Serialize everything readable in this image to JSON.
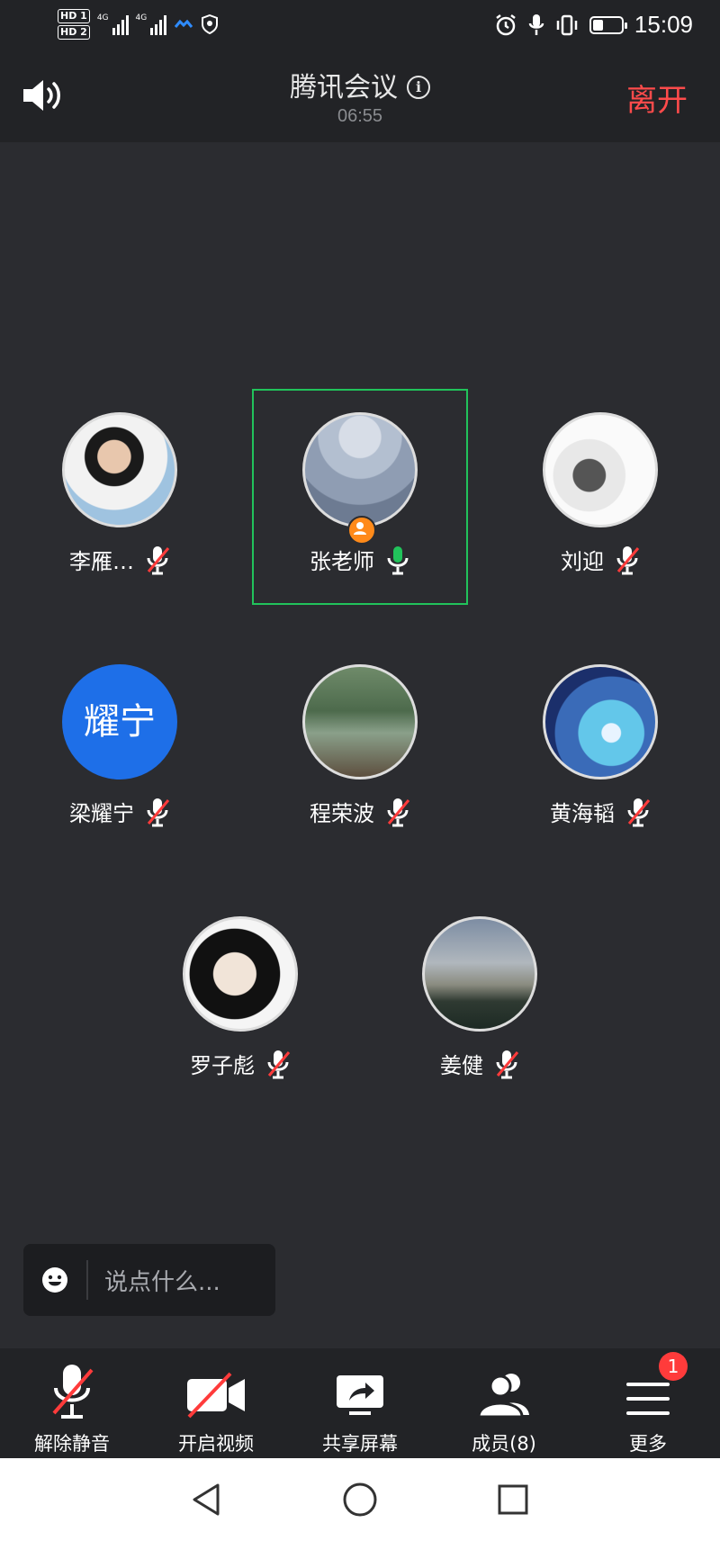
{
  "status_bar": {
    "sim1": "HD 1",
    "sim2": "HD 2",
    "network": "4G",
    "time": "15:09",
    "icons": [
      "hd-icon",
      "signal-icon",
      "wifi-icon",
      "vpn-icon",
      "alarm-icon",
      "mic-icon",
      "vibrate-icon",
      "battery-icon"
    ],
    "battery_level": 0.35
  },
  "header": {
    "title": "腾讯会议",
    "timer": "06:55",
    "leave_label": "离开",
    "info_glyph": "i"
  },
  "participants": [
    {
      "name": "李雁…",
      "mic": "muted",
      "avatar_type": "photo",
      "active": false
    },
    {
      "name": "张老师",
      "mic": "on",
      "avatar_type": "photo",
      "active": true,
      "host": true
    },
    {
      "name": "刘迎",
      "mic": "muted",
      "avatar_type": "photo",
      "active": false
    },
    {
      "name": "梁耀宁",
      "mic": "muted",
      "avatar_type": "text",
      "avatar_text": "耀宁",
      "active": false
    },
    {
      "name": "程荣波",
      "mic": "muted",
      "avatar_type": "photo",
      "active": false
    },
    {
      "name": "黄海韬",
      "mic": "muted",
      "avatar_type": "photo",
      "active": false
    },
    {
      "name": "罗子彪",
      "mic": "muted",
      "avatar_type": "photo",
      "active": false
    },
    {
      "name": "姜健",
      "mic": "muted",
      "avatar_type": "photo",
      "active": false
    }
  ],
  "chat": {
    "placeholder": "说点什么..."
  },
  "toolbar": {
    "unmute_label": "解除静音",
    "video_label": "开启视频",
    "share_label": "共享屏幕",
    "members_label": "成员(8)",
    "more_label": "更多",
    "more_badge": "1"
  },
  "colors": {
    "background": "#2b2c30",
    "leave": "#ff4b4b",
    "active_border": "#21c35b",
    "text_avatar": "#1e6fe8",
    "badge": "#ff3b3b"
  }
}
